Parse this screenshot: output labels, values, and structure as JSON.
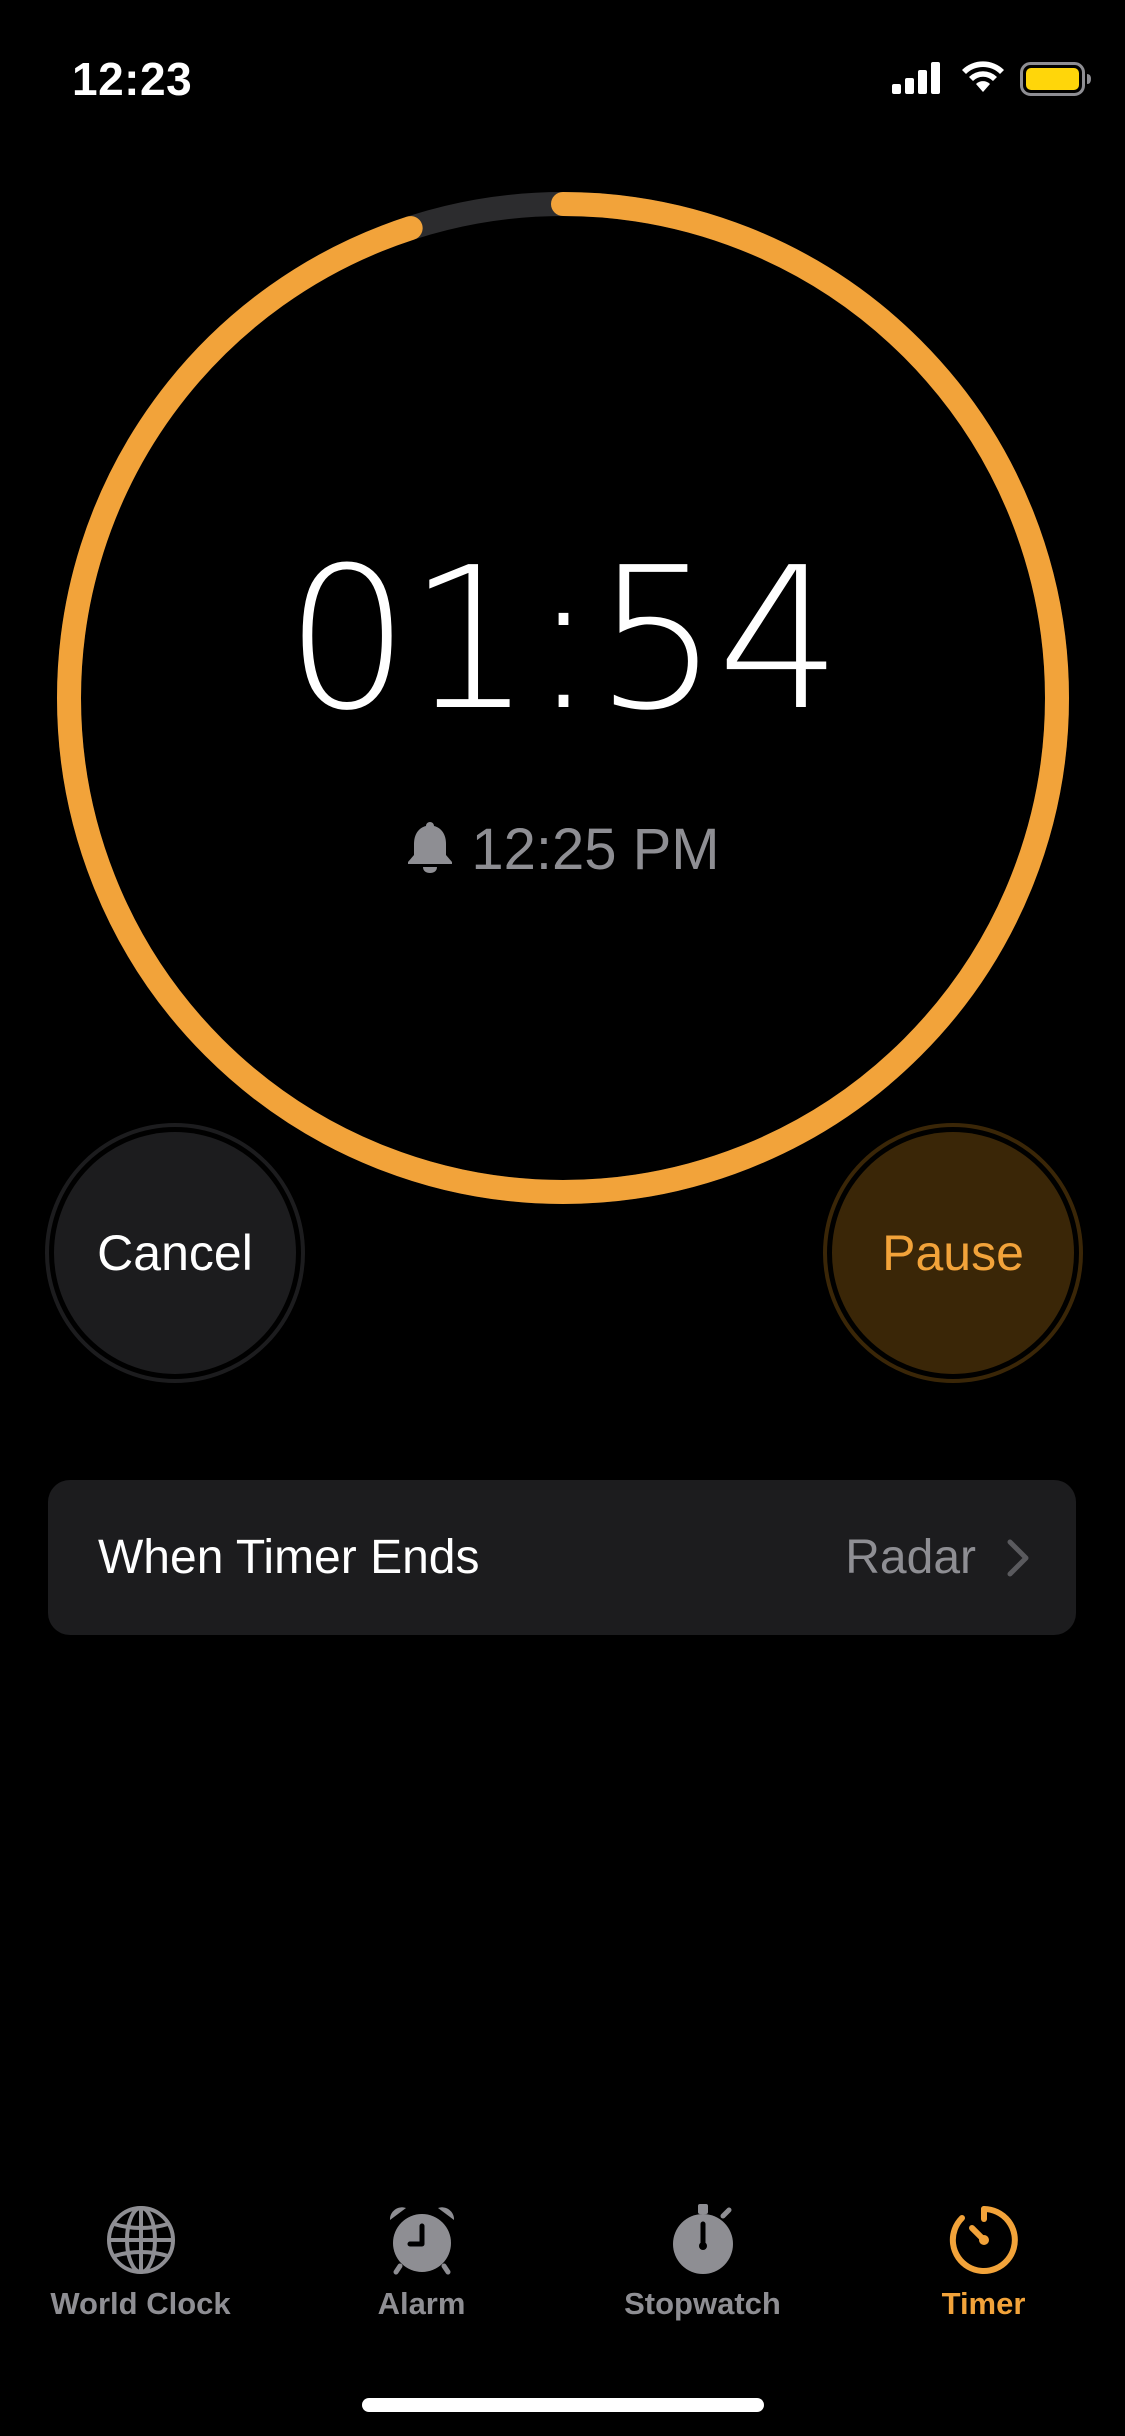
{
  "status_bar": {
    "time": "12:23",
    "icons": [
      "cellular-signal-icon",
      "wifi-icon",
      "battery-icon"
    ]
  },
  "timer": {
    "remaining": "01:54",
    "end_time": "12:25 PM",
    "progress_remaining_fraction": 0.95,
    "ring_color": "#F2A33A",
    "track_color": "#2C2C2E"
  },
  "buttons": {
    "cancel_label": "Cancel",
    "pause_label": "Pause"
  },
  "settings": {
    "when_timer_ends_label": "When Timer Ends",
    "when_timer_ends_value": "Radar"
  },
  "tab_bar": {
    "tabs": [
      {
        "label": "World Clock",
        "icon": "globe-icon",
        "active": false
      },
      {
        "label": "Alarm",
        "icon": "alarm-clock-icon",
        "active": false
      },
      {
        "label": "Stopwatch",
        "icon": "stopwatch-icon",
        "active": false
      },
      {
        "label": "Timer",
        "icon": "timer-icon",
        "active": true
      }
    ]
  },
  "colors": {
    "accent": "#F2A33A",
    "background": "#000000",
    "secondary_text": "#8E8E93",
    "cell_background": "#1C1C1E"
  }
}
